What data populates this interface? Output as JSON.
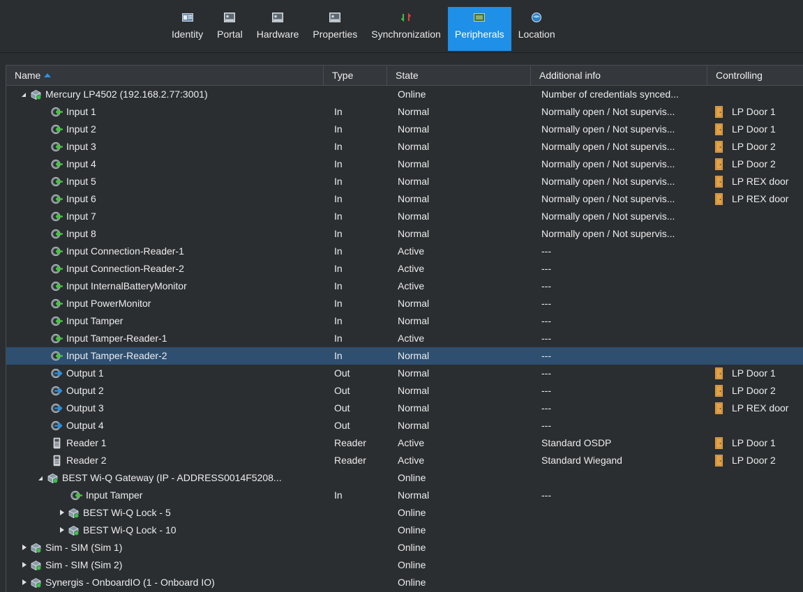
{
  "tabs": [
    {
      "label": "Identity",
      "icon": "identity-icon",
      "active": false
    },
    {
      "label": "Portal",
      "icon": "portal-icon",
      "active": false
    },
    {
      "label": "Hardware",
      "icon": "hardware-icon",
      "active": false
    },
    {
      "label": "Properties",
      "icon": "properties-icon",
      "active": false
    },
    {
      "label": "Synchronization",
      "icon": "sync-icon",
      "active": false
    },
    {
      "label": "Peripherals",
      "icon": "peripherals-icon",
      "active": true
    },
    {
      "label": "Location",
      "icon": "location-icon",
      "active": false
    }
  ],
  "columns": {
    "name": "Name",
    "type": "Type",
    "state": "State",
    "info": "Additional info",
    "controlling": "Controlling"
  },
  "rows": [
    {
      "level": 0,
      "expander": "open",
      "icon": "unit",
      "name": "Mercury LP4502 (192.168.2.77:3001)",
      "type": "",
      "state": "Online",
      "info": "Number of credentials synced...",
      "ctrl": ""
    },
    {
      "level": 1,
      "expander": "",
      "icon": "input",
      "name": "Input 1",
      "type": "In",
      "state": "Normal",
      "info": "Normally open / Not supervis...",
      "ctrl": "LP Door 1"
    },
    {
      "level": 1,
      "expander": "",
      "icon": "input",
      "name": "Input 2",
      "type": "In",
      "state": "Normal",
      "info": "Normally open / Not supervis...",
      "ctrl": "LP Door 1"
    },
    {
      "level": 1,
      "expander": "",
      "icon": "input",
      "name": "Input 3",
      "type": "In",
      "state": "Normal",
      "info": "Normally open / Not supervis...",
      "ctrl": "LP Door 2"
    },
    {
      "level": 1,
      "expander": "",
      "icon": "input",
      "name": "Input 4",
      "type": "In",
      "state": "Normal",
      "info": "Normally open / Not supervis...",
      "ctrl": "LP Door 2"
    },
    {
      "level": 1,
      "expander": "",
      "icon": "input",
      "name": "Input 5",
      "type": "In",
      "state": "Normal",
      "info": "Normally open / Not supervis...",
      "ctrl": "LP REX door"
    },
    {
      "level": 1,
      "expander": "",
      "icon": "input",
      "name": "Input 6",
      "type": "In",
      "state": "Normal",
      "info": "Normally open / Not supervis...",
      "ctrl": "LP REX door"
    },
    {
      "level": 1,
      "expander": "",
      "icon": "input",
      "name": "Input 7",
      "type": "In",
      "state": "Normal",
      "info": "Normally open / Not supervis...",
      "ctrl": ""
    },
    {
      "level": 1,
      "expander": "",
      "icon": "input",
      "name": "Input 8",
      "type": "In",
      "state": "Normal",
      "info": "Normally open / Not supervis...",
      "ctrl": ""
    },
    {
      "level": 1,
      "expander": "",
      "icon": "input",
      "name": "Input Connection-Reader-1",
      "type": "In",
      "state": "Active",
      "info": "---",
      "ctrl": ""
    },
    {
      "level": 1,
      "expander": "",
      "icon": "input",
      "name": "Input Connection-Reader-2",
      "type": "In",
      "state": "Active",
      "info": "---",
      "ctrl": ""
    },
    {
      "level": 1,
      "expander": "",
      "icon": "input",
      "name": "Input InternalBatteryMonitor",
      "type": "In",
      "state": "Active",
      "info": "---",
      "ctrl": ""
    },
    {
      "level": 1,
      "expander": "",
      "icon": "input",
      "name": "Input PowerMonitor",
      "type": "In",
      "state": "Normal",
      "info": "---",
      "ctrl": ""
    },
    {
      "level": 1,
      "expander": "",
      "icon": "input",
      "name": "Input Tamper",
      "type": "In",
      "state": "Normal",
      "info": "---",
      "ctrl": ""
    },
    {
      "level": 1,
      "expander": "",
      "icon": "input",
      "name": "Input Tamper-Reader-1",
      "type": "In",
      "state": "Active",
      "info": "---",
      "ctrl": ""
    },
    {
      "level": 1,
      "expander": "",
      "icon": "input",
      "name": "Input Tamper-Reader-2",
      "type": "In",
      "state": "Normal",
      "info": "---",
      "ctrl": "",
      "selected": true
    },
    {
      "level": 1,
      "expander": "",
      "icon": "output",
      "name": "Output 1",
      "type": "Out",
      "state": "Normal",
      "info": "---",
      "ctrl": "LP Door 1"
    },
    {
      "level": 1,
      "expander": "",
      "icon": "output",
      "name": "Output 2",
      "type": "Out",
      "state": "Normal",
      "info": "---",
      "ctrl": "LP Door 2"
    },
    {
      "level": 1,
      "expander": "",
      "icon": "output",
      "name": "Output 3",
      "type": "Out",
      "state": "Normal",
      "info": "---",
      "ctrl": "LP REX door"
    },
    {
      "level": 1,
      "expander": "",
      "icon": "output",
      "name": "Output 4",
      "type": "Out",
      "state": "Normal",
      "info": "---",
      "ctrl": ""
    },
    {
      "level": 1,
      "expander": "",
      "icon": "reader",
      "name": "Reader 1",
      "type": "Reader",
      "state": "Active",
      "info": "Standard OSDP",
      "ctrl": "LP Door 1"
    },
    {
      "level": 1,
      "expander": "",
      "icon": "reader",
      "name": "Reader 2",
      "type": "Reader",
      "state": "Active",
      "info": "Standard Wiegand",
      "ctrl": "LP Door 2"
    },
    {
      "level": 1,
      "expander": "open",
      "icon": "unit",
      "name": "BEST Wi-Q Gateway (IP - ADDRESS0014F5208...",
      "type": "",
      "state": "Online",
      "info": "",
      "ctrl": ""
    },
    {
      "level": 2,
      "expander": "",
      "icon": "input",
      "name": "Input Tamper",
      "type": "In",
      "state": "Normal",
      "info": "---",
      "ctrl": ""
    },
    {
      "level": 2,
      "expander": "closed",
      "icon": "unit",
      "name": "BEST Wi-Q Lock - 5",
      "type": "",
      "state": "Online",
      "info": "",
      "ctrl": ""
    },
    {
      "level": 2,
      "expander": "closed",
      "icon": "unit",
      "name": "BEST Wi-Q Lock - 10",
      "type": "",
      "state": "Online",
      "info": "",
      "ctrl": ""
    },
    {
      "level": 0,
      "expander": "closed",
      "icon": "unit",
      "name": "Sim - SIM (Sim 1)",
      "type": "",
      "state": "Online",
      "info": "",
      "ctrl": ""
    },
    {
      "level": 0,
      "expander": "closed",
      "icon": "unit",
      "name": "Sim - SIM (Sim 2)",
      "type": "",
      "state": "Online",
      "info": "",
      "ctrl": ""
    },
    {
      "level": 0,
      "expander": "closed",
      "icon": "unit",
      "name": "Synergis - OnboardIO (1 - Onboard IO)",
      "type": "",
      "state": "Online",
      "info": "",
      "ctrl": ""
    }
  ],
  "colors": {
    "accent": "#1e90e8",
    "selected_row": "#2e4f70",
    "input_icon": "#3db83d",
    "output_icon": "#2a8fe0",
    "door_icon": "#d08a2a"
  }
}
